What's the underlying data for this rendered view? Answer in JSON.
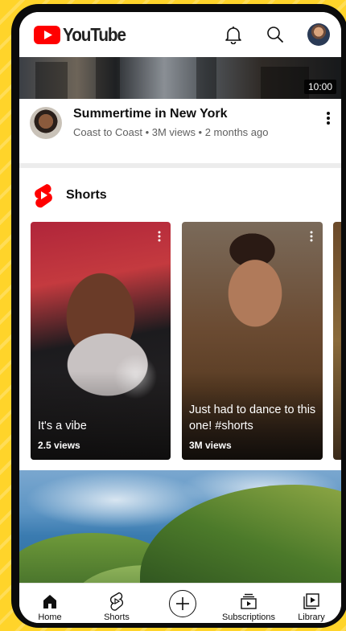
{
  "app": {
    "name": "YouTube"
  },
  "header": {
    "icons": [
      "youtube-logo-icon",
      "bell-icon",
      "search-icon",
      "avatar"
    ]
  },
  "video": {
    "duration": "10:00",
    "title": "Summertime in New York",
    "meta": "Coast to Coast • 3M views • 2 months ago"
  },
  "shorts": {
    "label": "Shorts",
    "items": [
      {
        "title": "It's a vibe",
        "views": "2.5 views"
      },
      {
        "title": "Just had to dance to this one! #shorts",
        "views": "3M views"
      }
    ]
  },
  "nav": {
    "items": [
      {
        "label": "Home",
        "icon": "home-icon",
        "active": true
      },
      {
        "label": "Shorts",
        "icon": "shorts-icon"
      },
      {
        "label": "",
        "icon": "create-plus-icon"
      },
      {
        "label": "Subscriptions",
        "icon": "subscriptions-icon"
      },
      {
        "label": "Library",
        "icon": "library-icon"
      }
    ]
  },
  "colors": {
    "brand_red": "#FF0000",
    "background_yellow": "#FFD42A",
    "text_primary": "#0F0F0F",
    "text_secondary": "#606060"
  }
}
